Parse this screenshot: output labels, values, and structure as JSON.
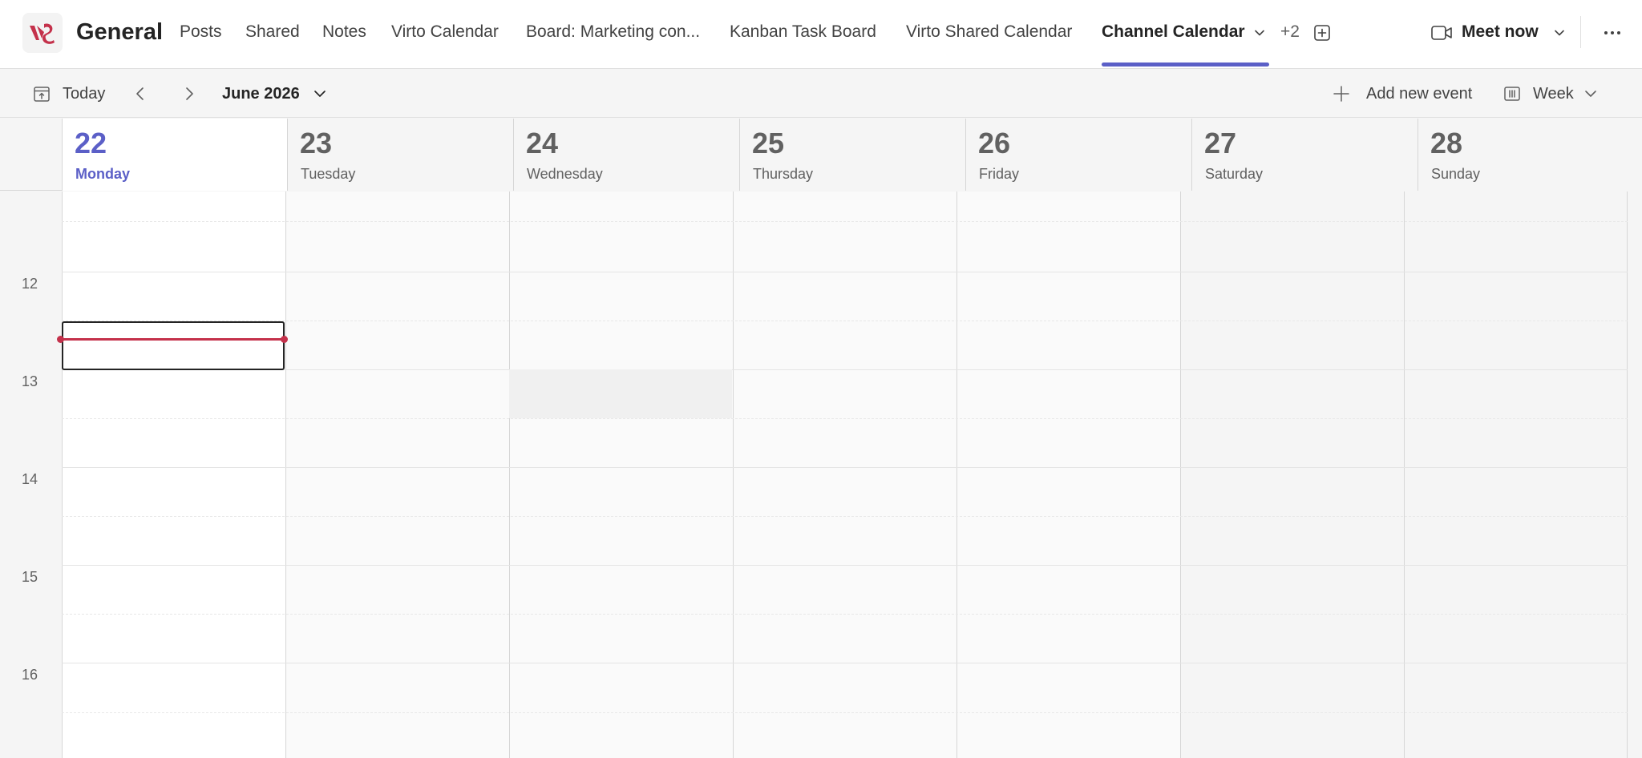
{
  "header": {
    "channel_name": "General",
    "tabs": [
      {
        "label": "Posts"
      },
      {
        "label": "Shared"
      },
      {
        "label": "Notes"
      },
      {
        "label": "Virto Calendar"
      },
      {
        "label": "Board: Marketing con..."
      },
      {
        "label": "Kanban Task Board"
      },
      {
        "label": "Virto Shared Calendar"
      },
      {
        "label": "Channel Calendar",
        "active": true
      }
    ],
    "more_tabs": "+2",
    "meet_now": "Meet now",
    "accent_color": "#5b5fc7",
    "logo_color": "#c4314b"
  },
  "toolbar": {
    "today_label": "Today",
    "month_label": "June 2026",
    "add_event_label": "Add new event",
    "view_label": "Week"
  },
  "days": [
    {
      "num": "22",
      "name": "Monday",
      "today": true
    },
    {
      "num": "23",
      "name": "Tuesday"
    },
    {
      "num": "24",
      "name": "Wednesday"
    },
    {
      "num": "25",
      "name": "Thursday"
    },
    {
      "num": "26",
      "name": "Friday"
    },
    {
      "num": "27",
      "name": "Saturday"
    },
    {
      "num": "28",
      "name": "Sunday"
    }
  ],
  "hours": [
    "12",
    "13",
    "14",
    "15",
    "16"
  ],
  "current_time_color": "#c4314b"
}
